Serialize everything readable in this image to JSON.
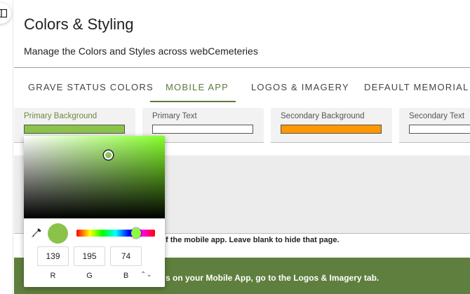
{
  "page": {
    "title": "Colors & Styling",
    "subtitle": "Manage the Colors and Styles across webCemeteries"
  },
  "tabs": [
    {
      "label": "GRAVE STATUS COLORS",
      "active": false
    },
    {
      "label": "MOBILE APP",
      "active": true
    },
    {
      "label": "LOGOS & IMAGERY",
      "active": false
    },
    {
      "label": "DEFAULT MEMORIAL LA",
      "active": false
    }
  ],
  "color_fields": [
    {
      "label": "Primary Background",
      "color": "#8bc34a",
      "focused": true
    },
    {
      "label": "Primary Text",
      "color": "#ffffff",
      "focused": false
    },
    {
      "label": "Secondary Background",
      "color": "#ff9800",
      "focused": false
    },
    {
      "label": "Secondary Text",
      "color": "#ffffff",
      "focused": false
    }
  ],
  "help_text": "f the mobile app. Leave blank to hide that page.",
  "banner_text": "s on your Mobile App, go to the Logos & Imagery tab.",
  "picker": {
    "hue_color": "#86ff2a",
    "preview_color": "#8bc34a",
    "r": "139",
    "g": "195",
    "b": "74",
    "labels": {
      "r": "R",
      "g": "G",
      "b": "B"
    },
    "mode_toggle": "⌃⌄"
  },
  "colors": {
    "accent": "#5b7a3a",
    "banner": "#5f7f3e"
  },
  "icons": {
    "collapse": "collapse-icon",
    "eyedropper": "eyedropper-icon"
  }
}
